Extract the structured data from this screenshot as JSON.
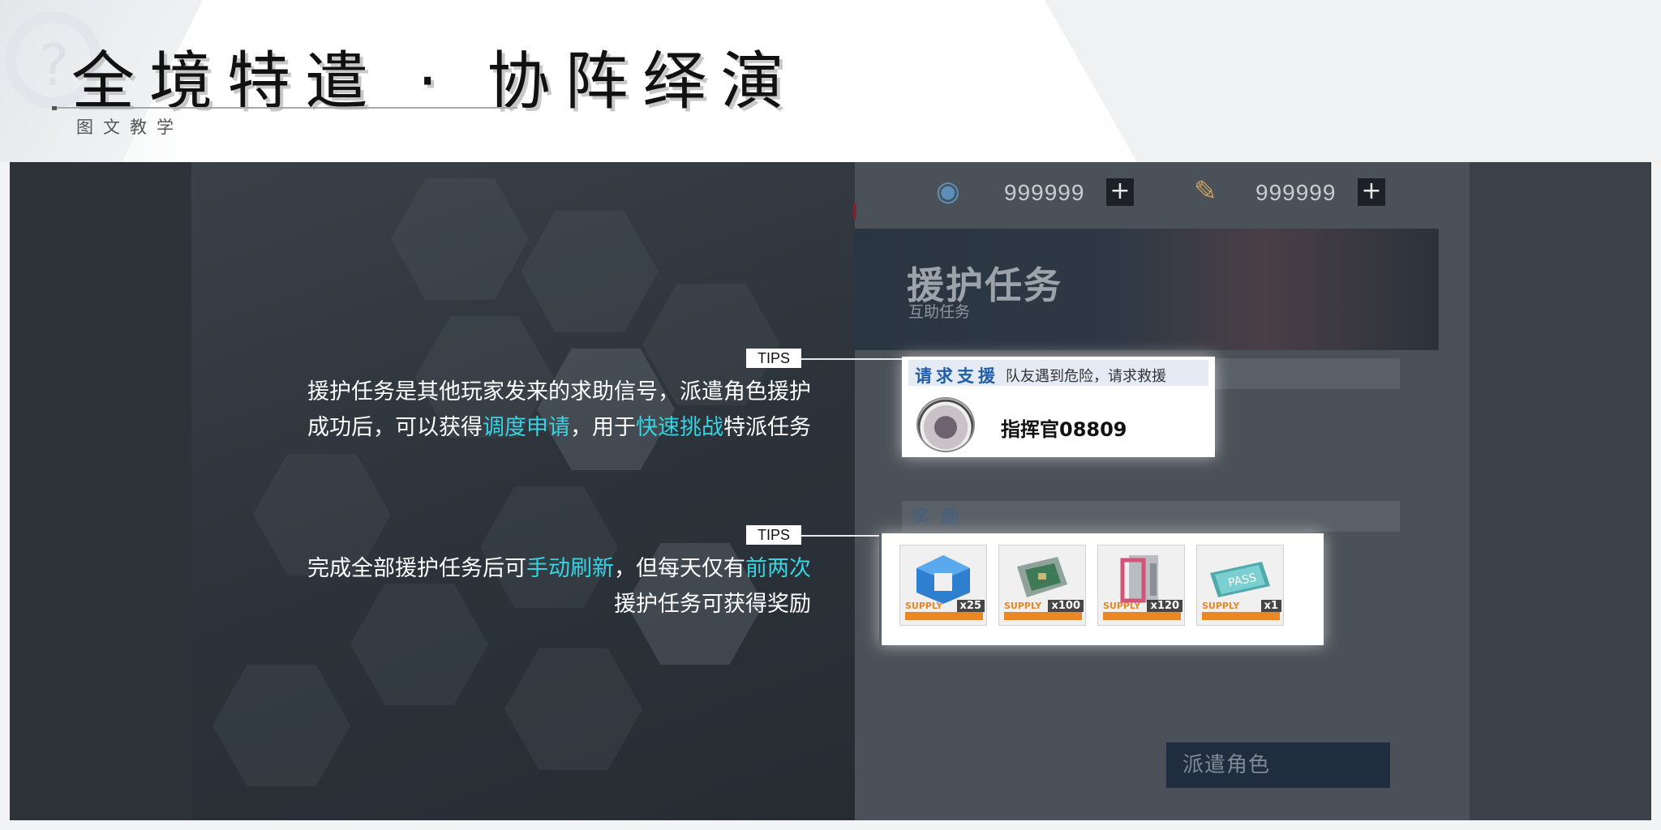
{
  "header": {
    "title": "全境特遣 · 协阵绎演",
    "subtitle": "图文教学"
  },
  "currency": {
    "primary_value": "999999",
    "secondary_value": "999999",
    "primary_icon": "cube-icon",
    "secondary_icon": "pen-icon",
    "add_symbol": "+"
  },
  "mission": {
    "title": "援护任务",
    "subtitle": "互助任务",
    "reward_heading": "奖 励",
    "dispatch_label": "派遣角色"
  },
  "tips": [
    {
      "label": "TIPS",
      "line1": "援护任务是其他玩家发来的求助信号，派遣角色援护",
      "line2_a": "成功后，可以获得",
      "line2_hl1": "调度申请",
      "line2_b": "，用于",
      "line2_hl2": "快速挑战",
      "line2_c": "特派任务"
    },
    {
      "label": "TIPS",
      "line1_a": "完成全部援护任务后可",
      "line1_hl1": "手动刷新",
      "line1_b": "，但每天仅有",
      "line1_hl2": "前两次",
      "line2": "援护任务可获得奖励"
    }
  ],
  "request": {
    "label": "请求支援",
    "message": "队友遇到危险，请求救援",
    "player_name": "指挥官08809"
  },
  "rewards": [
    {
      "count": "x25",
      "tag": "SUPPLY",
      "art": "blue-cube"
    },
    {
      "count": "x100",
      "tag": "SUPPLY",
      "art": "circuit-board"
    },
    {
      "count": "x120",
      "tag": "SUPPLY",
      "art": "pink-frame"
    },
    {
      "count": "x1",
      "tag": "SUPPLY",
      "art": "pass-card",
      "art_text": "PASS"
    }
  ],
  "colors": {
    "highlight": "#37d3e2",
    "request_label": "#1f5ea8",
    "star_bar": "#e98625"
  }
}
